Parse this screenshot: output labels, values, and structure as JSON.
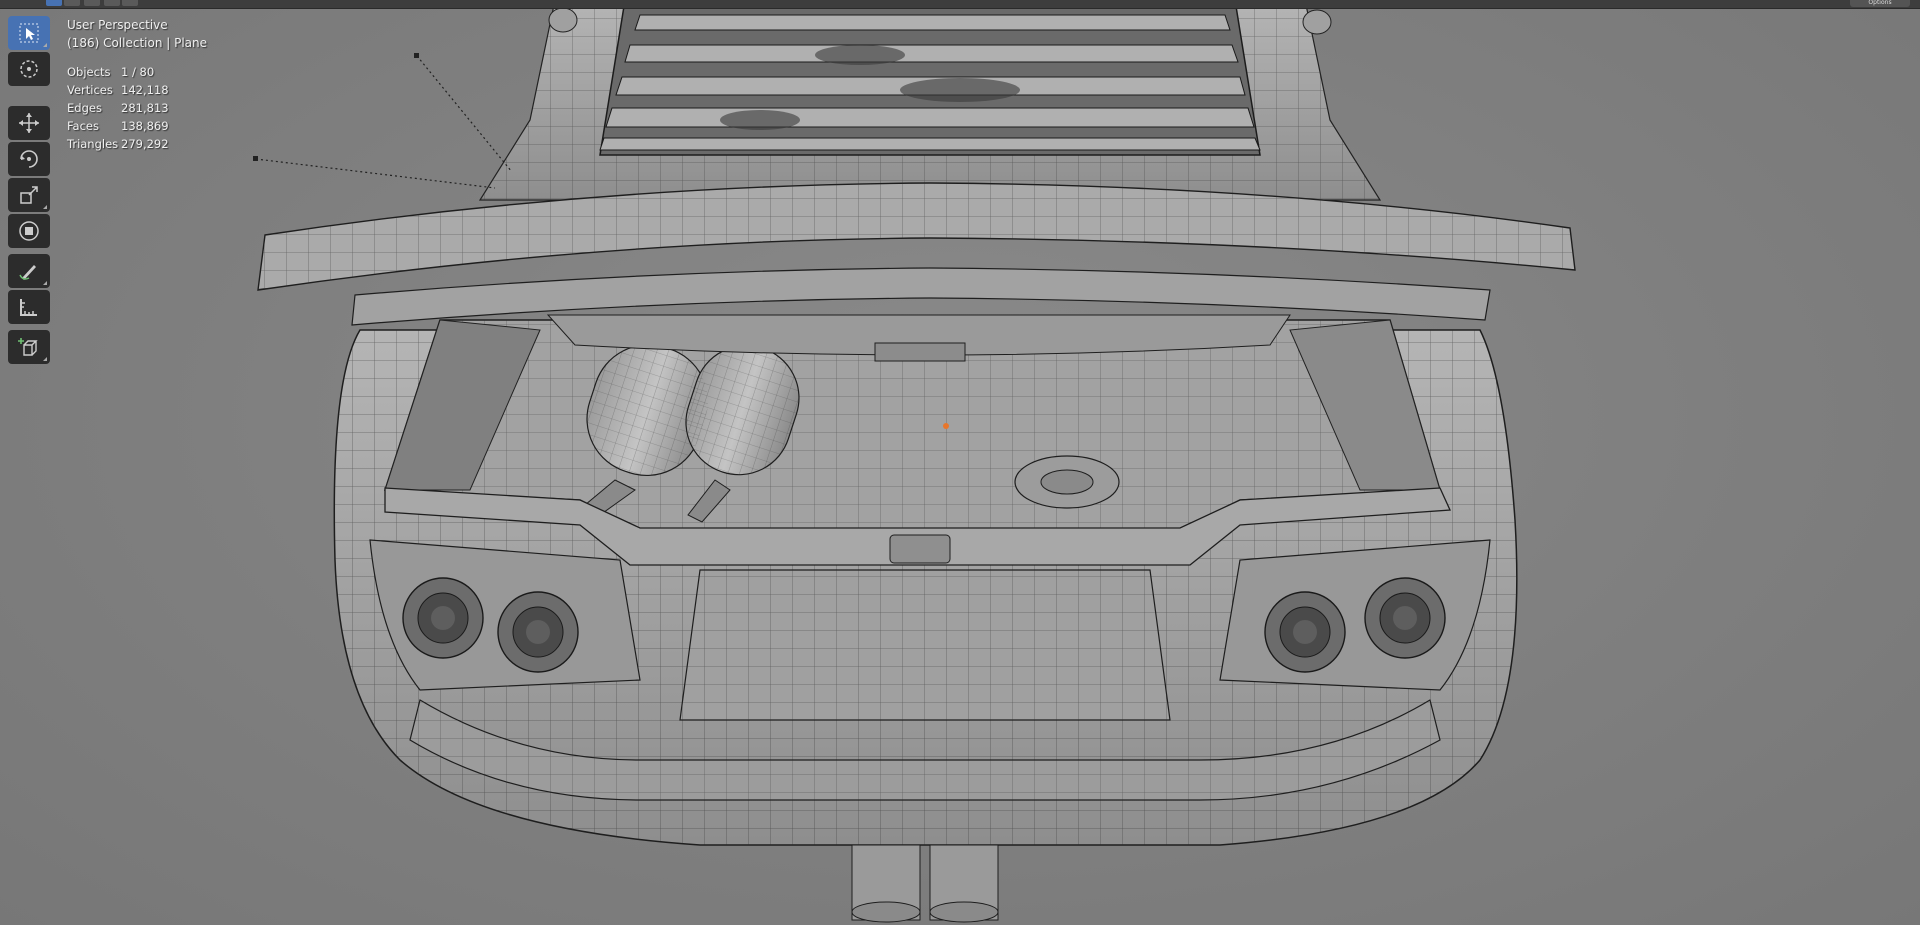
{
  "viewport": {
    "perspective_label": "User Perspective",
    "collection_label": "(186) Collection | Plane"
  },
  "stats": [
    {
      "label": "Objects",
      "value": "1 / 80"
    },
    {
      "label": "Vertices",
      "value": "142,118"
    },
    {
      "label": "Edges",
      "value": "281,813"
    },
    {
      "label": "Faces",
      "value": "138,869"
    },
    {
      "label": "Triangles",
      "value": "279,292"
    }
  ],
  "toolbar": {
    "tools": [
      {
        "name": "select-box",
        "icon": "cursor-select-icon",
        "active": true
      },
      {
        "name": "cursor",
        "icon": "3d-cursor-icon",
        "active": false
      },
      {
        "name": "move",
        "icon": "move-arrows-icon",
        "active": false
      },
      {
        "name": "rotate",
        "icon": "rotate-icon",
        "active": false
      },
      {
        "name": "scale",
        "icon": "scale-icon",
        "active": false
      },
      {
        "name": "transform",
        "icon": "transform-icon",
        "active": false
      },
      {
        "name": "annotate",
        "icon": "annotate-pencil-icon",
        "active": false
      },
      {
        "name": "measure",
        "icon": "measure-ruler-icon",
        "active": false
      },
      {
        "name": "add-cube",
        "icon": "add-cube-icon",
        "active": false
      }
    ]
  },
  "topbar": {
    "options_label": "Options"
  },
  "colors": {
    "background": "#7f7f7f",
    "active_tool": "#4772b3",
    "tool_bg": "#2c2c2c",
    "mesh_fill": "#a8a8a8",
    "wire": "#1e1e1e",
    "origin": "#e8762b"
  }
}
